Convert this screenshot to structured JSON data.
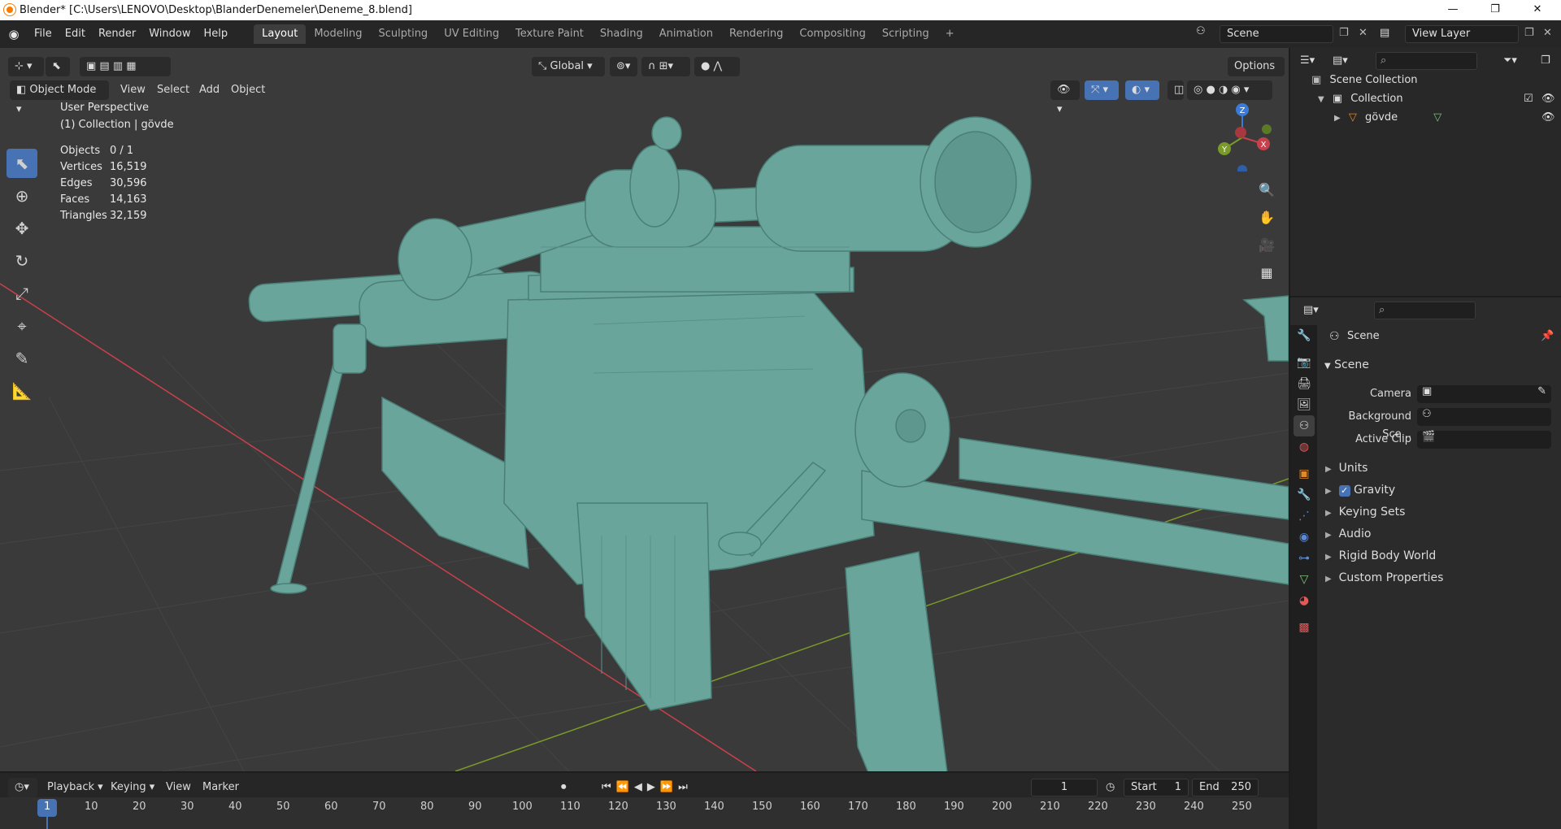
{
  "window": {
    "title": "Blender* [C:\\Users\\LENOVO\\Desktop\\BlanderDenemeler\\Deneme_8.blend]",
    "minimize": "—",
    "maximize": "❐",
    "close": "✕"
  },
  "menu": [
    "File",
    "Edit",
    "Render",
    "Window",
    "Help"
  ],
  "workspaces": [
    "Layout",
    "Modeling",
    "Sculpting",
    "UV Editing",
    "Texture Paint",
    "Shading",
    "Animation",
    "Rendering",
    "Compositing",
    "Scripting"
  ],
  "add_workspace": "+",
  "scene": {
    "name": "Scene",
    "view_layer": "View Layer"
  },
  "viewport": {
    "mode": "Object Mode",
    "menu": [
      "View",
      "Select",
      "Add",
      "Object"
    ],
    "orientation": "Global",
    "options": "Options",
    "info_line1": "User Perspective",
    "info_line2": "(1) Collection | gövde",
    "stats": [
      {
        "label": "Objects",
        "value": "0 / 1"
      },
      {
        "label": "Vertices",
        "value": "16,519"
      },
      {
        "label": "Edges",
        "value": "30,596"
      },
      {
        "label": "Faces",
        "value": "14,163"
      },
      {
        "label": "Triangles",
        "value": "32,159"
      }
    ],
    "gizmo": {
      "x": "X",
      "y": "Y",
      "z": "Z"
    },
    "model_color": "#6aa59c"
  },
  "outliner": {
    "scene_collection": "Scene Collection",
    "collection": "Collection",
    "object": "gövde"
  },
  "properties": {
    "context": "Scene",
    "panel": "Scene",
    "camera_label": "Camera",
    "bg_scene_label": "Background Sce...",
    "active_clip_label": "Active Clip",
    "subpanels": [
      "Units",
      "Gravity",
      "Keying Sets",
      "Audio",
      "Rigid Body World",
      "Custom Properties"
    ]
  },
  "timeline": {
    "menu": [
      "Playback",
      "Keying",
      "View",
      "Marker"
    ],
    "current_frame": "1",
    "start_label": "Start",
    "start_value": "1",
    "end_label": "End",
    "end_value": "250",
    "ticks": [
      "1",
      "10",
      "20",
      "30",
      "40",
      "50",
      "60",
      "70",
      "80",
      "90",
      "100",
      "110",
      "120",
      "130",
      "140",
      "150",
      "160",
      "170",
      "180",
      "190",
      "200",
      "210",
      "220",
      "230",
      "240",
      "250"
    ]
  },
  "colors": {
    "accent": "#4772b3",
    "x_axis": "#c9404a",
    "y_axis": "#7a9a2a",
    "z_axis": "#3a7ad8"
  }
}
